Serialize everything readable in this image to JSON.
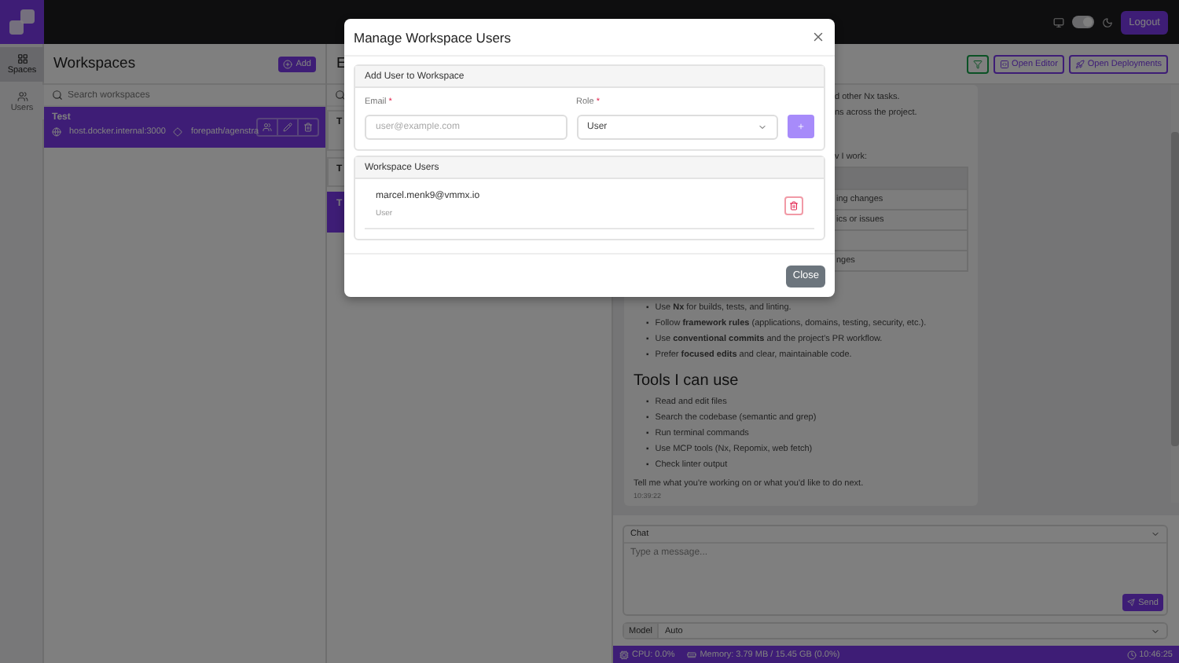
{
  "top_bar": {
    "theme_toggle": {
      "on": true
    },
    "logout": "Logout"
  },
  "nav": [
    {
      "label": "Spaces",
      "selected": true
    },
    {
      "label": "Users",
      "selected": false
    }
  ],
  "workspaces": {
    "title": "Workspaces",
    "add": "Add",
    "search": {
      "placeholder": "Search workspaces"
    },
    "items": [
      {
        "name": "Test",
        "host": "host.docker.internal:3000",
        "repo": "forepath/agenstra",
        "selected": true
      }
    ]
  },
  "column_2": {
    "heading": "E",
    "cards": [
      {
        "title": "T",
        "selected": false
      },
      {
        "title": "T",
        "selected": false
      },
      {
        "title": "T",
        "selected": true
      }
    ]
  },
  "chat": {
    "toolbar": [
      "Open Editor",
      "Open Deployments"
    ],
    "message": {
      "bullet": "▪",
      "lines": [
        "d other Nx tasks.",
        "ns across the project.",
        "v I work:"
      ],
      "table_rows": [
        "ing changes",
        "ics or issues",
        "",
        "nges"
      ],
      "bullets": [
        "Use **Nx** for builds, tests, and linting.",
        "Follow **framework rules** (applications, domains, testing, security, etc.).",
        "Use **conventional commits** and the project's PR workflow.",
        "Prefer **focused edits** and clear, maintainable code."
      ],
      "heading": "Tools I can use",
      "tools": [
        "Read and edit files",
        "Search the codebase (semantic and grep)",
        "Run terminal commands",
        "Use MCP tools (Nx, Repomix, web fetch)",
        "Check linter output"
      ],
      "closing": "Tell me what you're working on or what you'd like to do next.",
      "time": "10:39:22"
    },
    "mode": "Chat",
    "input": {
      "placeholder": "Type a message..."
    },
    "send": "Send",
    "model_label": "Model",
    "model": "Auto"
  },
  "status_bar": {
    "cpu": "CPU: 0.0%",
    "memory": "Memory: 3.79 MB / 15.45 GB  (0.0%)",
    "clock": "10:46:25"
  },
  "modal": {
    "title": "Manage Workspace Users",
    "add_section": {
      "title": "Add User to Workspace",
      "required_mark": "*",
      "email_label": "Email",
      "email": {
        "placeholder": "user@example.com"
      },
      "role_label": "Role",
      "role": "User"
    },
    "users_section": {
      "title": "Workspace Users",
      "users": [
        {
          "email": "marcel.menk9@vmmx.io",
          "role": "User"
        }
      ]
    },
    "close": "Close"
  }
}
